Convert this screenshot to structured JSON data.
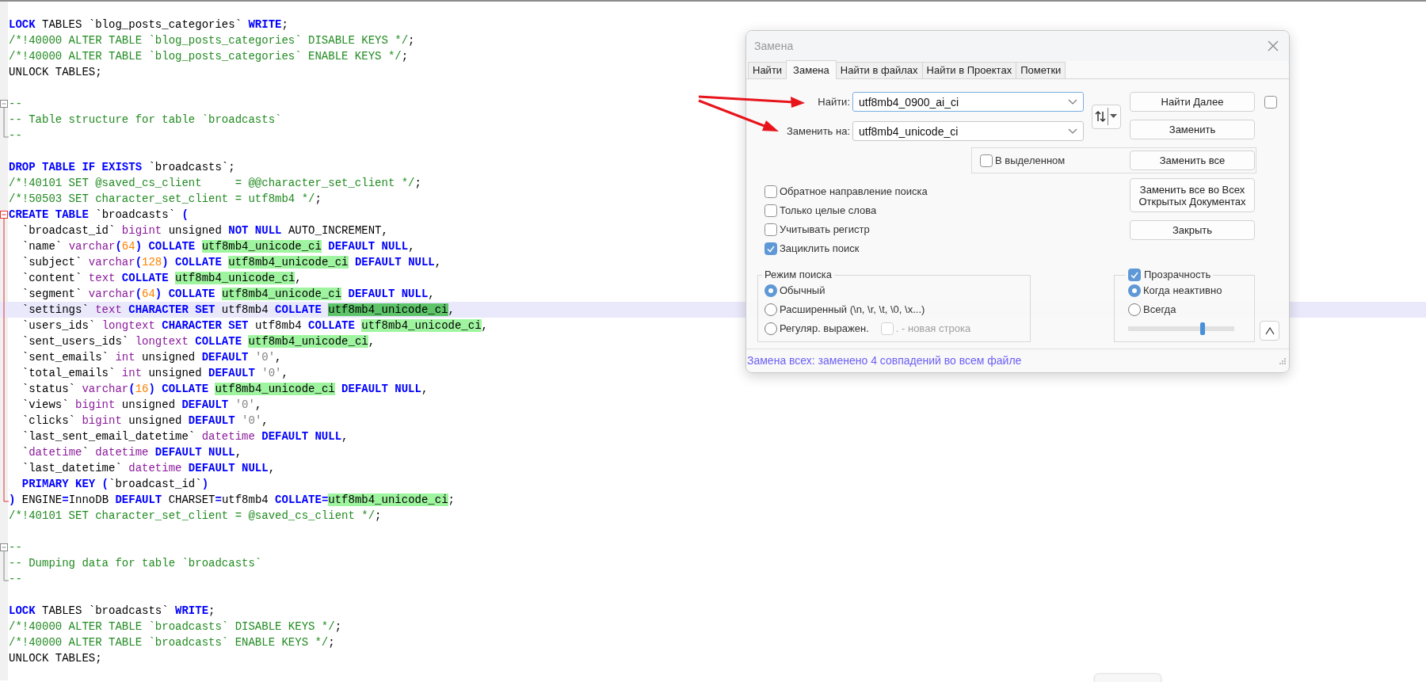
{
  "editor": {
    "lines": [
      {
        "current": false,
        "tokens": [
          {
            "kind": "kw",
            "text": "LOCK"
          },
          {
            "kind": "tx",
            "text": " TABLES `blog_posts_categories` "
          },
          {
            "kind": "kw",
            "text": "WRITE"
          },
          {
            "kind": "tx",
            "text": ";"
          }
        ]
      },
      {
        "current": false,
        "tokens": [
          {
            "kind": "cm",
            "text": "/*!40000 ALTER TABLE `blog_posts_categories` DISABLE KEYS */"
          },
          {
            "kind": "tx",
            "text": ";"
          }
        ]
      },
      {
        "current": false,
        "tokens": [
          {
            "kind": "cm",
            "text": "/*!40000 ALTER TABLE `blog_posts_categories` ENABLE KEYS */"
          },
          {
            "kind": "tx",
            "text": ";"
          }
        ]
      },
      {
        "current": false,
        "tokens": [
          {
            "kind": "tx",
            "text": "UNLOCK TABLES;"
          }
        ]
      },
      {
        "current": false
      },
      {
        "current": false,
        "fold": {
          "kind": "start",
          "active": false
        },
        "tokens": [
          {
            "kind": "cm",
            "text": "--"
          }
        ]
      },
      {
        "current": false,
        "fold": {
          "kind": "mid",
          "active": false
        },
        "tokens": [
          {
            "kind": "cm",
            "text": "-- Table structure for table `broadcasts`"
          }
        ]
      },
      {
        "current": false,
        "fold": {
          "kind": "end",
          "active": false
        },
        "tokens": [
          {
            "kind": "cm",
            "text": "--"
          }
        ]
      },
      {
        "current": false
      },
      {
        "current": false,
        "tokens": [
          {
            "kind": "kw",
            "text": "DROP TABLE IF EXISTS"
          },
          {
            "kind": "tx",
            "text": " `broadcasts`;"
          }
        ]
      },
      {
        "current": false,
        "tokens": [
          {
            "kind": "cm",
            "text": "/*!40101 SET @saved_cs_client     = @@character_set_client */"
          },
          {
            "kind": "tx",
            "text": ";"
          }
        ]
      },
      {
        "current": false,
        "tokens": [
          {
            "kind": "cm",
            "text": "/*!50503 SET character_set_client = utf8mb4 */"
          },
          {
            "kind": "tx",
            "text": ";"
          }
        ]
      },
      {
        "current": false,
        "fold": {
          "kind": "start",
          "active": true
        },
        "tokens": [
          {
            "kind": "kw",
            "text": "CREATE TABLE"
          },
          {
            "kind": "tx",
            "text": " `broadcasts` "
          },
          {
            "kind": "kw",
            "text": "("
          }
        ]
      },
      {
        "current": false,
        "fold": {
          "kind": "mid",
          "active": true
        },
        "tokens": [
          {
            "kind": "tx",
            "text": "  `broadcast_id` "
          },
          {
            "kind": "ty",
            "text": "bigint"
          },
          {
            "kind": "tx",
            "text": " unsigned "
          },
          {
            "kind": "kw",
            "text": "NOT NULL"
          },
          {
            "kind": "tx",
            "text": " AUTO_INCREMENT,"
          }
        ]
      },
      {
        "current": false,
        "fold": {
          "kind": "mid",
          "active": true
        },
        "tokens": [
          {
            "kind": "tx",
            "text": "  `name` "
          },
          {
            "kind": "ty",
            "text": "varchar"
          },
          {
            "kind": "kw",
            "text": "("
          },
          {
            "kind": "nu",
            "text": "64"
          },
          {
            "kind": "kw",
            "text": ") COLLATE "
          },
          {
            "kind": "match",
            "text": "utf8mb4_unicode_ci"
          },
          {
            "kind": "kw",
            "text": " DEFAULT NULL"
          },
          {
            "kind": "tx",
            "text": ","
          }
        ]
      },
      {
        "current": false,
        "fold": {
          "kind": "mid",
          "active": true
        },
        "tokens": [
          {
            "kind": "tx",
            "text": "  `subject` "
          },
          {
            "kind": "ty",
            "text": "varchar"
          },
          {
            "kind": "kw",
            "text": "("
          },
          {
            "kind": "nu",
            "text": "128"
          },
          {
            "kind": "kw",
            "text": ") COLLATE "
          },
          {
            "kind": "match",
            "text": "utf8mb4_unicode_ci"
          },
          {
            "kind": "kw",
            "text": " DEFAULT NULL"
          },
          {
            "kind": "tx",
            "text": ","
          }
        ]
      },
      {
        "current": false,
        "fold": {
          "kind": "mid",
          "active": true
        },
        "tokens": [
          {
            "kind": "tx",
            "text": "  `content` "
          },
          {
            "kind": "ty",
            "text": "text"
          },
          {
            "kind": "kw",
            "text": " COLLATE "
          },
          {
            "kind": "match",
            "text": "utf8mb4_unicode_ci"
          },
          {
            "kind": "tx",
            "text": ","
          }
        ]
      },
      {
        "current": false,
        "fold": {
          "kind": "mid",
          "active": true
        },
        "tokens": [
          {
            "kind": "tx",
            "text": "  `segment` "
          },
          {
            "kind": "ty",
            "text": "varchar"
          },
          {
            "kind": "kw",
            "text": "("
          },
          {
            "kind": "nu",
            "text": "64"
          },
          {
            "kind": "kw",
            "text": ") COLLATE "
          },
          {
            "kind": "match",
            "text": "utf8mb4_unicode_ci"
          },
          {
            "kind": "kw",
            "text": " DEFAULT NULL"
          },
          {
            "kind": "tx",
            "text": ","
          }
        ]
      },
      {
        "current": true,
        "fold": {
          "kind": "mid",
          "active": true
        },
        "tokens": [
          {
            "kind": "tx",
            "text": "  `settings` "
          },
          {
            "kind": "ty",
            "text": "text"
          },
          {
            "kind": "kw",
            "text": " CHARACTER SET "
          },
          {
            "kind": "tx",
            "text": "utf8mb4 "
          },
          {
            "kind": "kw",
            "text": "COLLATE "
          },
          {
            "kind": "match_selected",
            "text": "utf8mb4_unicode_ci"
          },
          {
            "kind": "tx",
            "text": ","
          }
        ]
      },
      {
        "current": false,
        "fold": {
          "kind": "mid",
          "active": true
        },
        "tokens": [
          {
            "kind": "tx",
            "text": "  `users_ids` "
          },
          {
            "kind": "ty",
            "text": "longtext"
          },
          {
            "kind": "kw",
            "text": " CHARACTER SET "
          },
          {
            "kind": "tx",
            "text": "utf8mb4 "
          },
          {
            "kind": "kw",
            "text": "COLLATE "
          },
          {
            "kind": "match",
            "text": "utf8mb4_unicode_ci"
          },
          {
            "kind": "tx",
            "text": ","
          }
        ]
      },
      {
        "current": false,
        "fold": {
          "kind": "mid",
          "active": true
        },
        "tokens": [
          {
            "kind": "tx",
            "text": "  `sent_users_ids` "
          },
          {
            "kind": "ty",
            "text": "longtext"
          },
          {
            "kind": "kw",
            "text": " COLLATE "
          },
          {
            "kind": "match",
            "text": "utf8mb4_unicode_ci"
          },
          {
            "kind": "tx",
            "text": ","
          }
        ]
      },
      {
        "current": false,
        "fold": {
          "kind": "mid",
          "active": true
        },
        "tokens": [
          {
            "kind": "tx",
            "text": "  `sent_emails` "
          },
          {
            "kind": "ty",
            "text": "int"
          },
          {
            "kind": "tx",
            "text": " unsigned "
          },
          {
            "kind": "kw",
            "text": "DEFAULT "
          },
          {
            "kind": "st",
            "text": "'0'"
          },
          {
            "kind": "tx",
            "text": ","
          }
        ]
      },
      {
        "current": false,
        "fold": {
          "kind": "mid",
          "active": true
        },
        "tokens": [
          {
            "kind": "tx",
            "text": "  `total_emails` "
          },
          {
            "kind": "ty",
            "text": "int"
          },
          {
            "kind": "tx",
            "text": " unsigned "
          },
          {
            "kind": "kw",
            "text": "DEFAULT "
          },
          {
            "kind": "st",
            "text": "'0'"
          },
          {
            "kind": "tx",
            "text": ","
          }
        ]
      },
      {
        "current": false,
        "fold": {
          "kind": "mid",
          "active": true
        },
        "tokens": [
          {
            "kind": "tx",
            "text": "  `status` "
          },
          {
            "kind": "ty",
            "text": "varchar"
          },
          {
            "kind": "kw",
            "text": "("
          },
          {
            "kind": "nu",
            "text": "16"
          },
          {
            "kind": "kw",
            "text": ") COLLATE "
          },
          {
            "kind": "match",
            "text": "utf8mb4_unicode_ci"
          },
          {
            "kind": "kw",
            "text": " DEFAULT NULL"
          },
          {
            "kind": "tx",
            "text": ","
          }
        ]
      },
      {
        "current": false,
        "fold": {
          "kind": "mid",
          "active": true
        },
        "tokens": [
          {
            "kind": "tx",
            "text": "  `views` "
          },
          {
            "kind": "ty",
            "text": "bigint"
          },
          {
            "kind": "tx",
            "text": " unsigned "
          },
          {
            "kind": "kw",
            "text": "DEFAULT "
          },
          {
            "kind": "st",
            "text": "'0'"
          },
          {
            "kind": "tx",
            "text": ","
          }
        ]
      },
      {
        "current": false,
        "fold": {
          "kind": "mid",
          "active": true
        },
        "tokens": [
          {
            "kind": "tx",
            "text": "  `clicks` "
          },
          {
            "kind": "ty",
            "text": "bigint"
          },
          {
            "kind": "tx",
            "text": " unsigned "
          },
          {
            "kind": "kw",
            "text": "DEFAULT "
          },
          {
            "kind": "st",
            "text": "'0'"
          },
          {
            "kind": "tx",
            "text": ","
          }
        ]
      },
      {
        "current": false,
        "fold": {
          "kind": "mid",
          "active": true
        },
        "tokens": [
          {
            "kind": "tx",
            "text": "  `last_sent_email_datetime` "
          },
          {
            "kind": "ty",
            "text": "datetime"
          },
          {
            "kind": "kw",
            "text": " DEFAULT NULL"
          },
          {
            "kind": "tx",
            "text": ","
          }
        ]
      },
      {
        "current": false,
        "fold": {
          "kind": "mid",
          "active": true
        },
        "tokens": [
          {
            "kind": "tx",
            "text": "  `"
          },
          {
            "kind": "ty",
            "text": "datetime"
          },
          {
            "kind": "tx",
            "text": "` "
          },
          {
            "kind": "ty",
            "text": "datetime"
          },
          {
            "kind": "kw",
            "text": " DEFAULT NULL"
          },
          {
            "kind": "tx",
            "text": ","
          }
        ]
      },
      {
        "current": false,
        "fold": {
          "kind": "mid",
          "active": true
        },
        "tokens": [
          {
            "kind": "tx",
            "text": "  `last_datetime` "
          },
          {
            "kind": "ty",
            "text": "datetime"
          },
          {
            "kind": "kw",
            "text": " DEFAULT NULL"
          },
          {
            "kind": "tx",
            "text": ","
          }
        ]
      },
      {
        "current": false,
        "fold": {
          "kind": "mid",
          "active": true
        },
        "tokens": [
          {
            "kind": "kw",
            "text": "  PRIMARY KEY ("
          },
          {
            "kind": "tx",
            "text": "`broadcast_id`"
          },
          {
            "kind": "kw",
            "text": ")"
          }
        ]
      },
      {
        "current": false,
        "fold": {
          "kind": "end",
          "active": true
        },
        "tokens": [
          {
            "kind": "kw",
            "text": ")"
          },
          {
            "kind": "tx",
            "text": " ENGINE"
          },
          {
            "kind": "kw",
            "text": "="
          },
          {
            "kind": "tx",
            "text": "InnoDB "
          },
          {
            "kind": "kw",
            "text": "DEFAULT"
          },
          {
            "kind": "tx",
            "text": " CHARSET"
          },
          {
            "kind": "kw",
            "text": "="
          },
          {
            "kind": "tx",
            "text": "utf8mb4 "
          },
          {
            "kind": "kw",
            "text": "COLLATE="
          },
          {
            "kind": "match",
            "text": "utf8mb4_unicode_ci"
          },
          {
            "kind": "tx",
            "text": ";"
          }
        ]
      },
      {
        "current": false,
        "tokens": [
          {
            "kind": "cm",
            "text": "/*!40101 SET character_set_client = @saved_cs_client */"
          },
          {
            "kind": "tx",
            "text": ";"
          }
        ]
      },
      {
        "current": false
      },
      {
        "current": false,
        "fold": {
          "kind": "start",
          "active": false
        },
        "tokens": [
          {
            "kind": "cm",
            "text": "--"
          }
        ]
      },
      {
        "current": false,
        "fold": {
          "kind": "mid",
          "active": false
        },
        "tokens": [
          {
            "kind": "cm",
            "text": "-- Dumping data for table `broadcasts`"
          }
        ]
      },
      {
        "current": false,
        "fold": {
          "kind": "end",
          "active": false
        },
        "tokens": [
          {
            "kind": "cm",
            "text": "--"
          }
        ]
      },
      {
        "current": false
      },
      {
        "current": false,
        "tokens": [
          {
            "kind": "kw",
            "text": "LOCK"
          },
          {
            "kind": "tx",
            "text": " TABLES `broadcasts` "
          },
          {
            "kind": "kw",
            "text": "WRITE"
          },
          {
            "kind": "tx",
            "text": ";"
          }
        ]
      },
      {
        "current": false,
        "tokens": [
          {
            "kind": "cm",
            "text": "/*!40000 ALTER TABLE `broadcasts` DISABLE KEYS */"
          },
          {
            "kind": "tx",
            "text": ";"
          }
        ]
      },
      {
        "current": false,
        "tokens": [
          {
            "kind": "cm",
            "text": "/*!40000 ALTER TABLE `broadcasts` ENABLE KEYS */"
          },
          {
            "kind": "tx",
            "text": ";"
          }
        ]
      },
      {
        "current": false,
        "tokens": [
          {
            "kind": "tx",
            "text": "UNLOCK TABLES;"
          }
        ]
      }
    ]
  },
  "dialog": {
    "title": "Замена",
    "tabs": [
      {
        "label": "Найти",
        "selected": false
      },
      {
        "label": "Замена",
        "selected": true
      },
      {
        "label": "Найти в файлах",
        "selected": false
      },
      {
        "label": "Найти в Проектах",
        "selected": false
      },
      {
        "label": "Пометки",
        "selected": false
      }
    ],
    "find": {
      "label": "Найти:",
      "value": "utf8mb4_0900_ai_ci",
      "focused": true
    },
    "replace": {
      "label": "Заменить на:",
      "value": "utf8mb4_unicode_ci",
      "focused": false
    },
    "buttons": [
      "Найти Далее",
      "Заменить",
      "Заменить все",
      "Заменить все во Всех Открытых Документах",
      "Закрыть"
    ],
    "side_checkbox": {
      "checked": false
    },
    "in_selection": {
      "label": "В выделенном",
      "checked": false
    },
    "options": [
      {
        "label": "Обратное направление поиска",
        "checked": false
      },
      {
        "label": "Только целые слова",
        "checked": false
      },
      {
        "label": "Учитывать регистр",
        "checked": false
      },
      {
        "label": "Зациклить поиск",
        "checked": true
      }
    ],
    "search_mode": {
      "title": "Режим поиска",
      "options": [
        {
          "label": "Обычный",
          "selected": true
        },
        {
          "label": "Расширенный (\\n, \\r, \\t, \\0, \\x...)",
          "selected": false
        },
        {
          "label": "Регуляр. выражен.",
          "selected": false
        }
      ],
      "newline_option": {
        "label": ". - новая строка",
        "checked": false,
        "disabled": true
      }
    },
    "transparency": {
      "label": "Прозрачность",
      "checked": true,
      "options": [
        {
          "label": "Когда неактивно",
          "selected": true
        },
        {
          "label": "Всегда",
          "selected": false
        }
      ],
      "level": 0.7
    },
    "status": "Замена всех: заменено 4 совпадений во всем файле"
  }
}
